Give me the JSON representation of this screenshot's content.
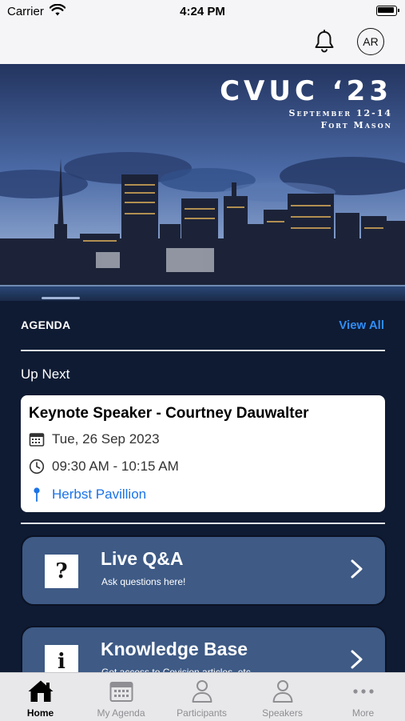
{
  "status_bar": {
    "carrier": "Carrier",
    "time": "4:24 PM"
  },
  "header": {
    "avatar_initials": "AR",
    "notifications_icon": "bell-icon"
  },
  "hero": {
    "title": "CVUC ‘23",
    "dates": "September 12-14",
    "venue": "Fort Mason"
  },
  "agenda": {
    "heading": "AGENDA",
    "view_all": "View All",
    "up_next_label": "Up Next",
    "next_session": {
      "title": "Keynote Speaker - Courtney Dauwalter",
      "date": "Tue, 26 Sep 2023",
      "time": "09:30 AM - 10:15 AM",
      "location": "Herbst Pavillion"
    }
  },
  "tiles": [
    {
      "icon_text": "?",
      "title": "Live Q&A",
      "subtitle": "Ask questions here!"
    },
    {
      "icon_text": "i",
      "title": "Knowledge Base",
      "subtitle": "Get access to Covision articles, etc."
    }
  ],
  "tab_bar": {
    "active_index": 0,
    "tabs": [
      {
        "label": "Home",
        "icon": "home-icon"
      },
      {
        "label": "My Agenda",
        "icon": "calendar-icon"
      },
      {
        "label": "Participants",
        "icon": "person-icon"
      },
      {
        "label": "Speakers",
        "icon": "person-icon"
      },
      {
        "label": "More",
        "icon": "more-icon"
      }
    ]
  },
  "colors": {
    "background": "#0f1b33",
    "tile": "#3e5a85",
    "link": "#2f8df5",
    "location": "#1a73e8"
  }
}
